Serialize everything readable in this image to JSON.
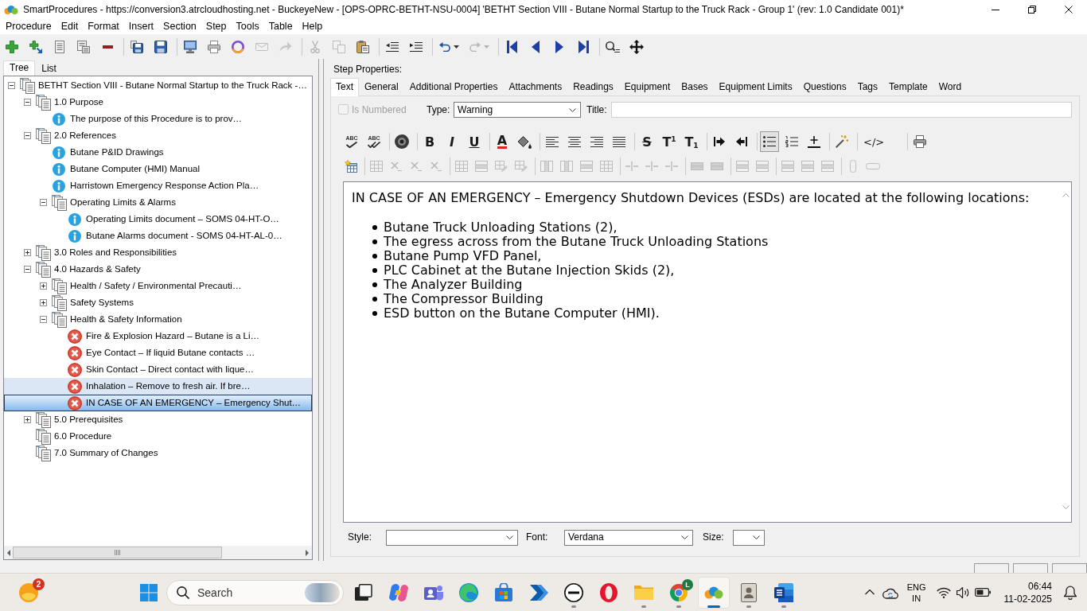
{
  "window": {
    "title": "SmartProcedures - https://conversion3.atrcloudhosting.net - BuckeyeNew - [OPS-OPRC-BETHT-NSU-0004] 'BETHT Section VIII - Butane Normal Startup to the Truck Rack - Group 1' (rev: 1.0 Candidate 001)*"
  },
  "menu": [
    {
      "label": "Procedure"
    },
    {
      "label": "Edit"
    },
    {
      "label": "Format"
    },
    {
      "label": "Insert"
    },
    {
      "label": "Section"
    },
    {
      "label": "Step"
    },
    {
      "label": "Tools"
    },
    {
      "label": "Table"
    },
    {
      "label": "Help"
    }
  ],
  "toolbar": [
    {
      "buttons": [
        {
          "kind": "add",
          "disabled": false
        },
        {
          "kind": "add-child",
          "disabled": false
        },
        {
          "kind": "list-page",
          "disabled": false
        },
        {
          "kind": "form-page",
          "disabled": false
        },
        {
          "kind": "remove",
          "disabled": false
        }
      ]
    },
    {
      "buttons": [
        {
          "kind": "save-all",
          "disabled": false
        },
        {
          "kind": "save",
          "disabled": false
        }
      ]
    },
    {
      "buttons": [
        {
          "kind": "publish",
          "disabled": false
        },
        {
          "kind": "print",
          "disabled": false
        },
        {
          "kind": "ring",
          "disabled": false
        },
        {
          "kind": "envelope",
          "disabled": true
        },
        {
          "kind": "forward",
          "disabled": true
        }
      ]
    },
    {
      "buttons": [
        {
          "kind": "cut",
          "disabled": true
        },
        {
          "kind": "copy",
          "disabled": true
        },
        {
          "kind": "paste",
          "disabled": false
        }
      ]
    },
    {
      "buttons": [
        {
          "kind": "outdent",
          "disabled": false
        },
        {
          "kind": "indent",
          "disabled": false
        }
      ]
    },
    {
      "buttons": [
        {
          "kind": "undo",
          "dropdown": true,
          "disabled": false
        },
        {
          "kind": "redo",
          "dropdown": true,
          "disabled": true
        }
      ]
    },
    {
      "buttons": [
        {
          "kind": "first",
          "disabled": false
        },
        {
          "kind": "previous",
          "disabled": false
        },
        {
          "kind": "next",
          "disabled": false
        },
        {
          "kind": "last",
          "disabled": false
        }
      ]
    },
    {
      "buttons": [
        {
          "kind": "find",
          "disabled": false
        },
        {
          "kind": "move",
          "disabled": false
        }
      ]
    }
  ],
  "left_tabs": [
    {
      "label": "Tree",
      "selected": true
    },
    {
      "label": "List",
      "selected": false
    }
  ],
  "tree": [
    {
      "label": "BETHT Section VIII - Butane Normal Startup to the Truck Rack -…",
      "kind": "section",
      "expanded": true,
      "selected": false,
      "hovered": false,
      "children": [
        {
          "label": "1.0 Purpose",
          "kind": "section",
          "expanded": true,
          "selected": false,
          "hovered": false,
          "children": [
            {
              "label": "The purpose of this Procedure is to prov…",
              "kind": "info",
              "selected": false,
              "hovered": false
            }
          ]
        },
        {
          "label": "2.0 References",
          "kind": "section",
          "expanded": true,
          "selected": false,
          "hovered": false,
          "children": [
            {
              "label": "Butane P&ID Drawings",
              "kind": "info",
              "selected": false,
              "hovered": false
            },
            {
              "label": "Butane Computer (HMI) Manual",
              "kind": "info",
              "selected": false,
              "hovered": false
            },
            {
              "label": "Harristown Emergency Response Action Pla…",
              "kind": "info",
              "selected": false,
              "hovered": false
            },
            {
              "label": "Operating Limits & Alarms",
              "kind": "section",
              "expanded": true,
              "selected": false,
              "hovered": false,
              "children": [
                {
                  "label": "Operating Limits document – SOMS 04-HT-O…",
                  "kind": "info",
                  "selected": false,
                  "hovered": false
                },
                {
                  "label": "Butane Alarms document - SOMS 04-HT-AL-0…",
                  "kind": "info",
                  "selected": false,
                  "hovered": false
                }
              ]
            }
          ]
        },
        {
          "label": "3.0 Roles and Responsibilities",
          "kind": "section",
          "expanded": false,
          "selected": false,
          "hovered": false
        },
        {
          "label": "4.0 Hazards & Safety",
          "kind": "section",
          "expanded": true,
          "selected": false,
          "hovered": false,
          "children": [
            {
              "label": "Health / Safety / Environmental Precauti…",
              "kind": "section",
              "expanded": false,
              "selected": false,
              "hovered": false
            },
            {
              "label": "Safety Systems",
              "kind": "section",
              "expanded": false,
              "selected": false,
              "hovered": false
            },
            {
              "label": "Health & Safety Information",
              "kind": "section",
              "expanded": true,
              "selected": false,
              "hovered": false,
              "children": [
                {
                  "label": "Fire & Explosion Hazard – Butane is a Li…",
                  "kind": "hazard",
                  "selected": false,
                  "hovered": false
                },
                {
                  "label": "Eye Contact – If liquid Butane contacts …",
                  "kind": "hazard",
                  "selected": false,
                  "hovered": false
                },
                {
                  "label": "Skin Contact – Direct contact with lique…",
                  "kind": "hazard",
                  "selected": false,
                  "hovered": false
                },
                {
                  "label": "Inhalation – Remove to fresh air. If bre…",
                  "kind": "hazard",
                  "selected": false,
                  "hovered": true
                },
                {
                  "label": "IN CASE OF AN EMERGENCY – Emergency Shut…",
                  "kind": "hazard",
                  "selected": true,
                  "hovered": false
                }
              ]
            }
          ]
        },
        {
          "label": "5.0 Prerequisites",
          "kind": "section",
          "expanded": false,
          "selected": false,
          "hovered": false
        },
        {
          "label": "6.0 Procedure",
          "kind": "section",
          "selected": false,
          "hovered": false
        },
        {
          "label": "7.0 Summary of Changes",
          "kind": "section",
          "selected": false,
          "hovered": false
        }
      ]
    }
  ],
  "step_properties": {
    "label": "Step Properties:",
    "tabs": [
      {
        "label": "Text",
        "selected": true
      },
      {
        "label": "General",
        "selected": false
      },
      {
        "label": "Additional Properties",
        "selected": false
      },
      {
        "label": "Attachments",
        "selected": false
      },
      {
        "label": "Readings",
        "selected": false
      },
      {
        "label": "Equipment",
        "selected": false
      },
      {
        "label": "Bases",
        "selected": false
      },
      {
        "label": "Equipment Limits",
        "selected": false
      },
      {
        "label": "Questions",
        "selected": false
      },
      {
        "label": "Tags",
        "selected": false
      },
      {
        "label": "Template",
        "selected": false
      },
      {
        "label": "Word",
        "selected": false
      }
    ],
    "is_numbered": {
      "label": "Is Numbered",
      "checked": false,
      "disabled": true
    },
    "type": {
      "label": "Type:",
      "value": "Warning"
    },
    "title": {
      "label": "Title:"
    },
    "format_toolbar": {
      "row_1": [
        {
          "buttons": [
            {
              "kind": "spelling",
              "label": "ABC",
              "pressed": false
            },
            {
              "kind": "spelling-all",
              "label": "ABC",
              "pressed": false
            }
          ]
        },
        {
          "buttons": [
            {
              "kind": "sound",
              "pressed": false
            }
          ]
        },
        {
          "buttons": [
            {
              "kind": "bold",
              "label": "B",
              "pressed": false
            },
            {
              "kind": "italic",
              "label": "I",
              "pressed": false
            },
            {
              "kind": "underline",
              "label": "U",
              "pressed": false
            }
          ]
        },
        {
          "buttons": [
            {
              "kind": "font-color",
              "label": "A",
              "pressed": false
            },
            {
              "kind": "fill-color",
              "pressed": false
            }
          ]
        },
        {
          "buttons": [
            {
              "kind": "align-left",
              "pressed": false
            },
            {
              "kind": "align-center",
              "pressed": false
            },
            {
              "kind": "align-right",
              "pressed": false
            },
            {
              "kind": "justify",
              "pressed": false
            }
          ]
        },
        {
          "buttons": [
            {
              "kind": "strikethrough",
              "label": "S",
              "pressed": false
            },
            {
              "kind": "superscript",
              "label": "T$^{1}$",
              "pressed": false
            },
            {
              "kind": "subscript",
              "label": "T$_{1}$",
              "pressed": false
            }
          ]
        },
        {
          "buttons": [
            {
              "kind": "indent",
              "pressed": false
            },
            {
              "kind": "outdent",
              "pressed": false
            }
          ]
        },
        {
          "buttons": [
            {
              "kind": "bulleted-list",
              "pressed": true
            },
            {
              "kind": "numbered-list",
              "pressed": false
            },
            {
              "kind": "horizontal-rule",
              "pressed": false
            }
          ]
        },
        {
          "buttons": [
            {
              "kind": "wand",
              "pressed": false
            }
          ]
        },
        {
          "buttons": [
            {
              "kind": "source",
              "label": "</>",
              "pressed": false
            }
          ]
        },
        {
          "buttons": [
            {
              "kind": "print",
              "pressed": false
            }
          ]
        }
      ],
      "row_2": [
        {
          "buttons": [
            {
              "kind": "insert-table",
              "disabled": false
            }
          ]
        },
        {
          "buttons": [
            {
              "kind": "table",
              "disabled": true
            },
            {
              "kind": "cross",
              "disabled": true
            },
            {
              "kind": "cross",
              "disabled": true
            },
            {
              "kind": "cross",
              "disabled": true
            }
          ]
        },
        {
          "buttons": [
            {
              "kind": "table",
              "disabled": true
            },
            {
              "kind": "table-row",
              "disabled": true
            },
            {
              "kind": "table-pencil",
              "disabled": true
            },
            {
              "kind": "table-pencil",
              "disabled": true
            }
          ]
        },
        {
          "buttons": [
            {
              "kind": "table-column",
              "disabled": true
            },
            {
              "kind": "table-column",
              "disabled": true
            },
            {
              "kind": "table-row",
              "disabled": true
            },
            {
              "kind": "table",
              "disabled": true
            }
          ]
        },
        {
          "buttons": [
            {
              "kind": "split-lines",
              "disabled": true
            },
            {
              "kind": "split-lines",
              "disabled": true
            },
            {
              "kind": "split-lines",
              "disabled": true
            }
          ]
        },
        {
          "buttons": [
            {
              "kind": "merged-cells",
              "disabled": true
            },
            {
              "kind": "merged-cells",
              "disabled": true
            }
          ]
        },
        {
          "buttons": [
            {
              "kind": "table-row",
              "disabled": true
            },
            {
              "kind": "table-row",
              "disabled": true
            }
          ]
        },
        {
          "buttons": [
            {
              "kind": "table-row",
              "disabled": true
            },
            {
              "kind": "table-row",
              "disabled": true
            },
            {
              "kind": "table-row",
              "disabled": true
            }
          ]
        },
        {
          "buttons": [
            {
              "kind": "vertical-pill",
              "disabled": true
            },
            {
              "kind": "horizontal-pill",
              "disabled": true
            }
          ]
        }
      ]
    },
    "editor": {
      "paragraph": "IN CASE OF AN EMERGENCY – Emergency Shutdown Devices (ESDs) are located at the following locations:",
      "bullets": [
        "Butane Truck Unloading Stations (2),",
        "The egress across from the Butane Truck Unloading Stations",
        "Butane Pump VFD Panel,",
        "PLC Cabinet at the Butane Injection Skids (2),",
        "The Analyzer Building",
        "The Compressor Building",
        "ESD button on the Butane Computer (HMI)."
      ]
    },
    "style": {
      "label": "Style:"
    },
    "font": {
      "label": "Font:",
      "value": "Verdana"
    },
    "size": {
      "label": "Size:"
    }
  },
  "taskbar": {
    "widget": {
      "badge": "2"
    },
    "search": {
      "placeholder": "Search"
    },
    "apps": [
      {
        "kind": "task-view",
        "running": false,
        "active": false
      },
      {
        "kind": "ribbon",
        "running": false,
        "active": false
      },
      {
        "kind": "people",
        "running": false,
        "active": false
      },
      {
        "kind": "swirl",
        "running": false,
        "active": false
      },
      {
        "kind": "bag",
        "running": false,
        "active": false
      },
      {
        "kind": "chevrons",
        "running": false,
        "active": false
      },
      {
        "kind": "circle-logo",
        "running": true,
        "active": false
      },
      {
        "kind": "ring",
        "running": false,
        "active": false
      },
      {
        "kind": "folder",
        "running": true,
        "active": false
      },
      {
        "kind": "segmented-circle",
        "running": true,
        "active": false,
        "badge": "L"
      },
      {
        "kind": "blobs",
        "running": true,
        "active": true
      },
      {
        "kind": "id-card",
        "running": true,
        "active": false
      },
      {
        "kind": "document-tile",
        "running": true,
        "active": false
      }
    ],
    "tray": {
      "language": "ENG",
      "region": "IN",
      "time": "06:44",
      "date": "11-02-2025"
    }
  }
}
